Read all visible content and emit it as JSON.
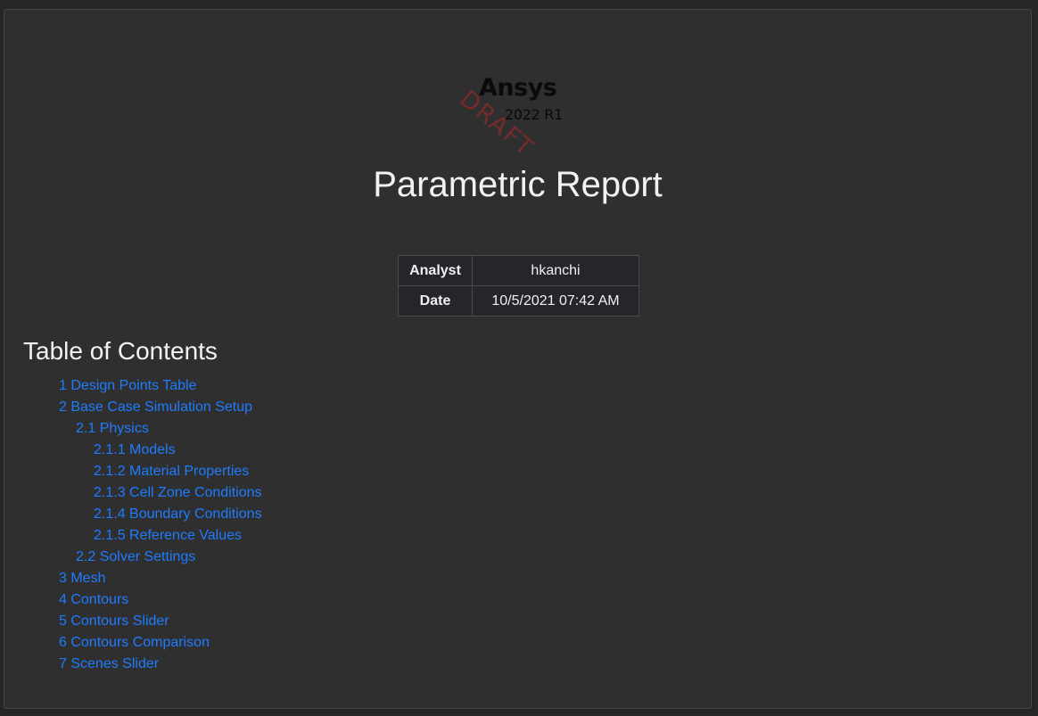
{
  "logo": {
    "name": "Ansys",
    "version": "2022 R1",
    "watermark": "DRAFT"
  },
  "title": "Parametric Report",
  "meta": {
    "rows": [
      {
        "label": "Analyst",
        "value": "hkanchi"
      },
      {
        "label": "Date",
        "value": "10/5/2021 07:42 AM"
      }
    ]
  },
  "toc": {
    "title": "Table of Contents",
    "items": [
      {
        "label": "1 Design Points Table",
        "level": 1
      },
      {
        "label": "2 Base Case Simulation Setup",
        "level": 1
      },
      {
        "label": "2.1 Physics",
        "level": 2
      },
      {
        "label": "2.1.1 Models",
        "level": 3
      },
      {
        "label": "2.1.2 Material Properties",
        "level": 3
      },
      {
        "label": "2.1.3 Cell Zone Conditions",
        "level": 3
      },
      {
        "label": "2.1.4 Boundary Conditions",
        "level": 3
      },
      {
        "label": "2.1.5 Reference Values",
        "level": 3
      },
      {
        "label": "2.2 Solver Settings",
        "level": 2
      },
      {
        "label": "3 Mesh",
        "level": 1
      },
      {
        "label": "4 Contours",
        "level": 1
      },
      {
        "label": "5 Contours Slider",
        "level": 1
      },
      {
        "label": "6 Contours Comparison",
        "level": 1
      },
      {
        "label": "7 Scenes Slider",
        "level": 1
      }
    ]
  },
  "colors": {
    "background": "#2f2f2f",
    "link": "#1f7bff",
    "text": "#f2f2f2",
    "watermark": "#8a2a2a"
  }
}
